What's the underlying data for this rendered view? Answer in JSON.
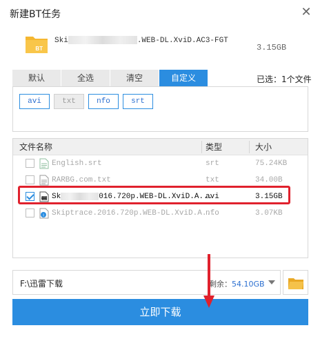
{
  "window": {
    "title": "新建BT任务",
    "close_glyph": "✕"
  },
  "task": {
    "folder_badge": "BT",
    "name_prefix": "Ski",
    "name_suffix": ".WEB-DL.XviD.AC3-FGT",
    "size": "3.15GB"
  },
  "filters": {
    "tabs": [
      {
        "label": "默认",
        "active": false
      },
      {
        "label": "全选",
        "active": false
      },
      {
        "label": "清空",
        "active": false
      },
      {
        "label": "自定义",
        "active": true
      }
    ],
    "selected_count": "已选：1个文件",
    "extensions": [
      {
        "label": "avi",
        "enabled": true
      },
      {
        "label": "txt",
        "enabled": false
      },
      {
        "label": "nfo",
        "enabled": true
      },
      {
        "label": "srt",
        "enabled": true
      }
    ]
  },
  "table": {
    "columns": {
      "name": "文件名称",
      "type": "类型",
      "size": "大小"
    },
    "rows": [
      {
        "name": "English.srt",
        "type": "srt",
        "size": "75.24KB",
        "checked": false,
        "icon": "text-file-icon"
      },
      {
        "name": "RARBG.com.txt",
        "type": "txt",
        "size": "34.00B",
        "checked": false,
        "icon": "text-file-icon"
      },
      {
        "name_prefix": "Sk",
        "name_suffix": "016.720p.WEB-DL.XviD.A...",
        "type": "avi",
        "size": "3.15GB",
        "checked": true,
        "icon": "video-file-icon"
      },
      {
        "name": "Skiptrace.2016.720p.WEB-DL.XviD.A...",
        "type": "nfo",
        "size": "3.07KB",
        "checked": false,
        "icon": "info-file-icon"
      }
    ]
  },
  "save": {
    "path": "F:\\迅雷下载",
    "space_label": "剩余：",
    "space_value": "54.10GB"
  },
  "download_button": "立即下载",
  "colors": {
    "accent": "#2b8de0",
    "highlight": "#e0212d",
    "folder": "#f5b731"
  }
}
